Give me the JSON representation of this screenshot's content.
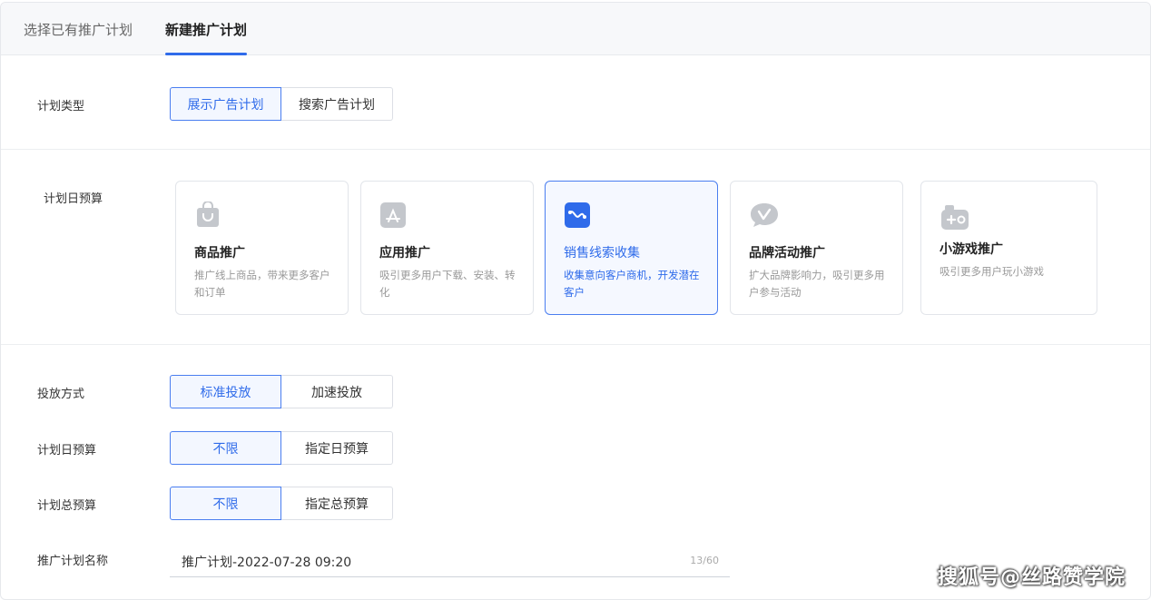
{
  "tabs": [
    {
      "label": "选择已有推广计划"
    },
    {
      "label": "新建推广计划"
    }
  ],
  "plan_type": {
    "label": "计划类型",
    "options": [
      "展示广告计划",
      "搜索广告计划"
    ],
    "selected": 0
  },
  "goal": {
    "label": "计划日预算",
    "cards": [
      {
        "icon": "shopping-bag-icon",
        "title": "商品推广",
        "desc": "推广线上商品，带来更多客户和订单"
      },
      {
        "icon": "app-store-icon",
        "title": "应用推广",
        "desc": "吸引更多用户下载、安装、转化"
      },
      {
        "icon": "lead-collection-icon",
        "title": "销售线索收集",
        "desc": "收集意向客户商机，开发潜在客户"
      },
      {
        "icon": "brand-chat-icon",
        "title": "品牌活动推广",
        "desc": "扩大品牌影响力，吸引更多用户参与活动"
      },
      {
        "icon": "game-controller-icon",
        "title": "小游戏推广",
        "desc": "吸引更多用户玩小游戏"
      }
    ],
    "selected": 2
  },
  "delivery": {
    "label": "投放方式",
    "options": [
      "标准投放",
      "加速投放"
    ]
  },
  "daily_budget": {
    "label": "计划日预算",
    "options": [
      "不限",
      "指定日预算"
    ]
  },
  "total_budget": {
    "label": "计划总预算",
    "options": [
      "不限",
      "指定总预算"
    ]
  },
  "plan_name": {
    "label": "推广计划名称",
    "value": "推广计划-2022-07-28 09:20",
    "count": "13/60"
  },
  "watermark": "搜狐号@丝路赞学院",
  "colors": {
    "accent": "#2f6bea",
    "icon_gray": "#c4c7cc"
  }
}
